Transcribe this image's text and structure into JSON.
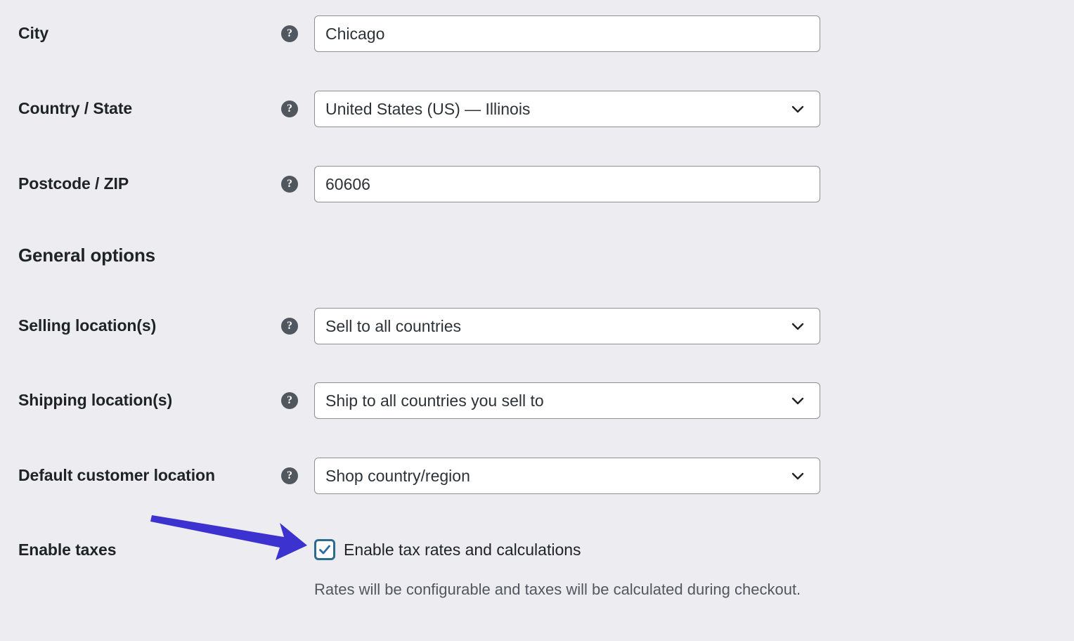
{
  "theme": {
    "page_background": "#edecf1",
    "label_color": "#1d2327",
    "field_border": "#8c8f94",
    "field_background": "#ffffff",
    "help_icon_background": "#50575e",
    "checkbox_accent": "#2f6b8f",
    "annotation_arrow_color": "#3b32cf",
    "help_text_color": "#50575e"
  },
  "form": {
    "rows": [
      {
        "label": "City",
        "help_icon": "question-mark-icon",
        "control": "text",
        "value": "Chicago",
        "placeholder": ""
      },
      {
        "label": "Country / State",
        "help_icon": "question-mark-icon",
        "control": "select",
        "value": "United States (US) — Illinois",
        "chevron_icon": "chevron-down-icon"
      },
      {
        "label": "Postcode / ZIP",
        "help_icon": "question-mark-icon",
        "control": "text",
        "value": "60606",
        "placeholder": ""
      }
    ]
  },
  "general_options": {
    "heading": "General options",
    "rows": [
      {
        "label": "Selling location(s)",
        "help_icon": "question-mark-icon",
        "control": "select",
        "value": "Sell to all countries",
        "chevron_icon": "chevron-down-icon"
      },
      {
        "label": "Shipping location(s)",
        "help_icon": "question-mark-icon",
        "control": "select",
        "value": "Ship to all countries you sell to",
        "chevron_icon": "chevron-down-icon"
      },
      {
        "label": "Default customer location",
        "help_icon": "question-mark-icon",
        "control": "select",
        "value": "Shop country/region",
        "chevron_icon": "chevron-down-icon"
      }
    ]
  },
  "enable_taxes": {
    "label": "Enable taxes",
    "checkbox_label": "Enable tax rates and calculations",
    "checkbox_checked": true,
    "checkbox_icon": "checkmark-icon",
    "description": "Rates will be configurable and taxes will be calculated during checkout."
  },
  "annotation": {
    "arrow_icon": "annotation-arrow-icon",
    "points_to": "enable-taxes-checkbox"
  }
}
